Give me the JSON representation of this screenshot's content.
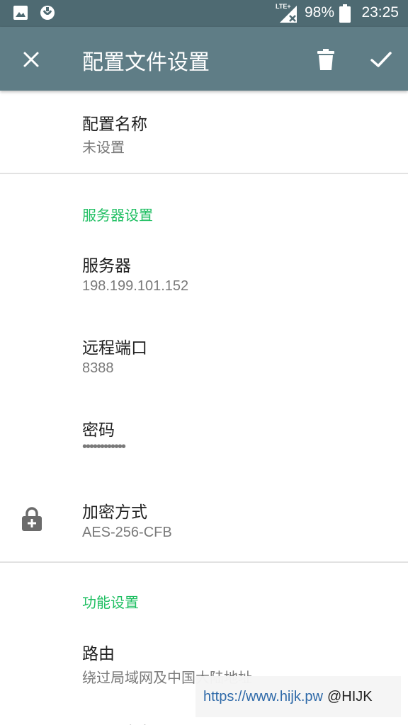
{
  "status_bar": {
    "network": "LTE+",
    "battery": "98%",
    "time": "23:25",
    "icons": [
      "image-icon",
      "app-notification-icon",
      "signal-icon",
      "battery-icon"
    ]
  },
  "app_bar": {
    "title": "配置文件设置",
    "icons": [
      "close-icon",
      "delete-icon",
      "check-icon"
    ]
  },
  "profile": {
    "name_title": "配置名称",
    "name_value": "未设置"
  },
  "server_section": {
    "header": "服务器设置",
    "server_title": "服务器",
    "server_value": "198.199.101.152",
    "port_title": "远程端口",
    "port_value": "8388",
    "password_title": "密码",
    "password_value": "••••••••••••",
    "cipher_title": "加密方式",
    "cipher_value": "AES-256-CFB"
  },
  "feature_section": {
    "header": "功能设置",
    "route_title": "路由",
    "route_value": "绕过局域网及中国大陆地址",
    "next_title": "路由"
  },
  "watermark": {
    "url": "https://www.hijk.pw",
    "handle": "@HIJK"
  },
  "colors": {
    "status_bar": "#4e6a72",
    "app_bar": "#5f7d86",
    "accent": "#1fbf62"
  }
}
